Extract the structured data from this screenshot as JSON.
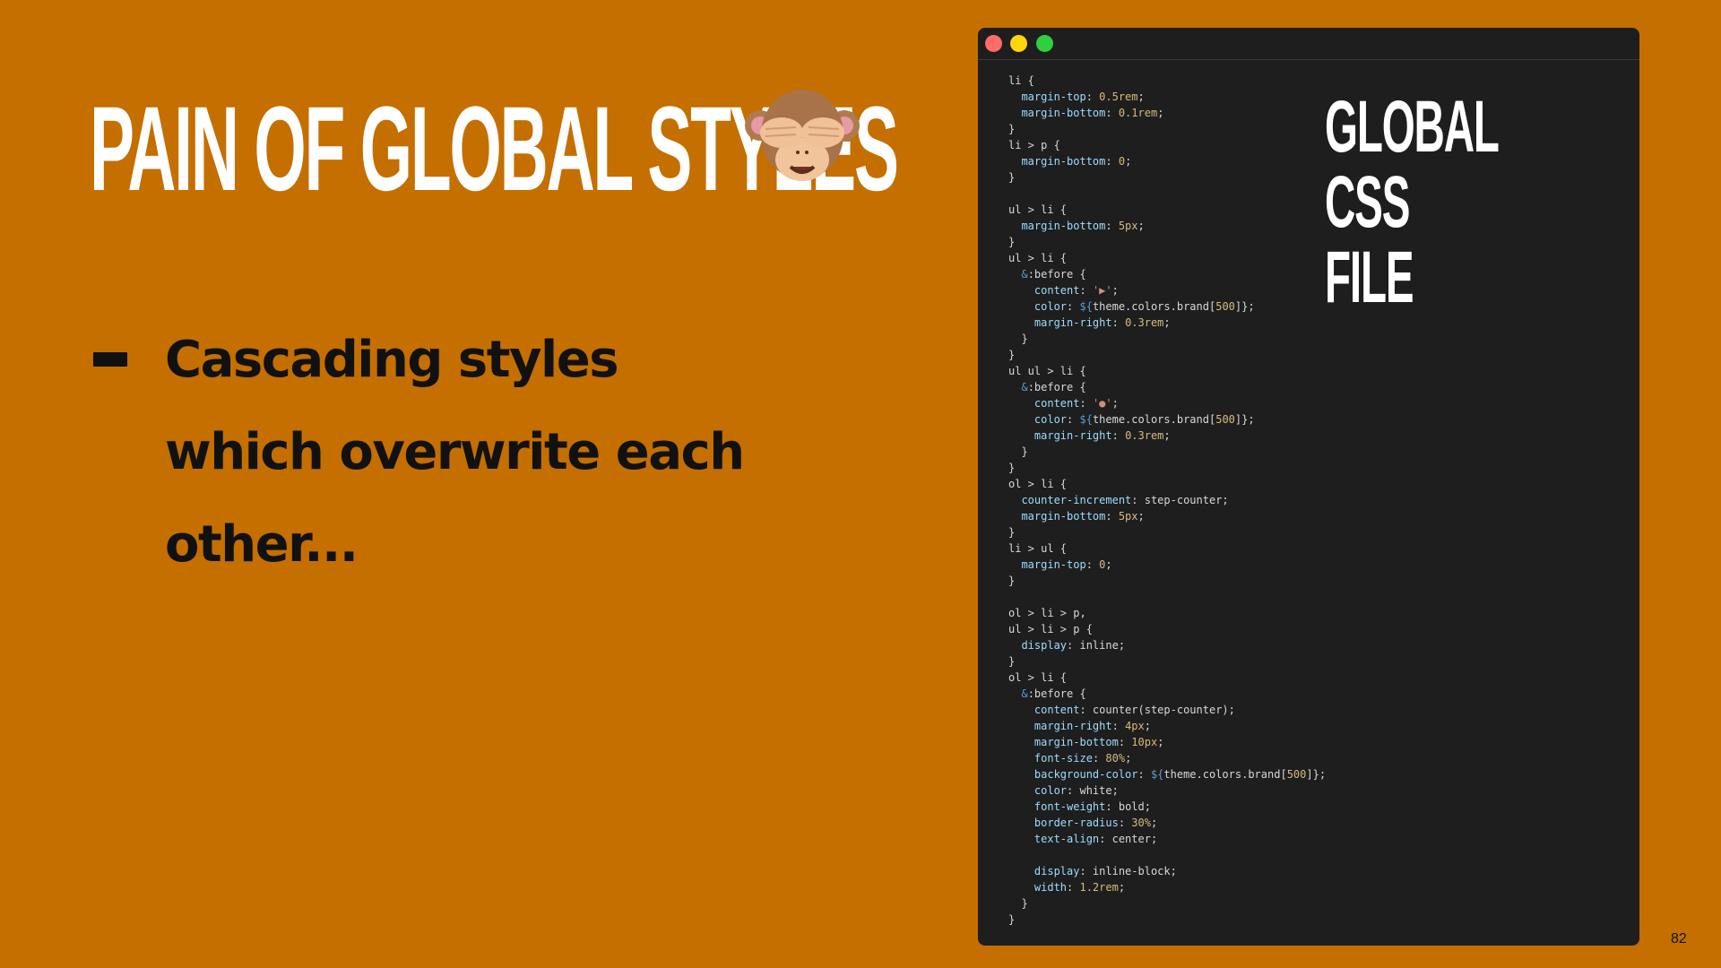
{
  "slide": {
    "title": "PAIN OF GLOBAL STYLES",
    "title_icon": "see-no-evil-monkey-icon",
    "bullets": [
      {
        "text": "Cascading styles which overwrite each other..."
      }
    ],
    "code_window": {
      "label": "GLOBAL CSS FILE",
      "controls": [
        "close-dot",
        "minimize-dot",
        "maximize-dot"
      ],
      "code": [
        "li {",
        "  margin-top: 0.5rem;",
        "  margin-bottom: 0.1rem;",
        "}",
        "li > p {",
        "  margin-bottom: 0;",
        "}",
        "",
        "ul > li {",
        "  margin-bottom: 5px;",
        "}",
        "ul > li {",
        "  &:before {",
        "    content: '▶';",
        "    color: ${theme.colors.brand[500]};",
        "    margin-right: 0.3rem;",
        "  }",
        "}",
        "ul ul > li {",
        "  &:before {",
        "    content: '●';",
        "    color: ${theme.colors.brand[500]};",
        "    margin-right: 0.3rem;",
        "  }",
        "}",
        "ol > li {",
        "  counter-increment: step-counter;",
        "  margin-bottom: 5px;",
        "}",
        "li > ul {",
        "  margin-top: 0;",
        "}",
        "",
        "ol > li > p,",
        "ul > li > p {",
        "  display: inline;",
        "}",
        "ol > li {",
        "  &:before {",
        "    content: counter(step-counter);",
        "    margin-right: 4px;",
        "    margin-bottom: 10px;",
        "    font-size: 80%;",
        "    background-color: ${theme.colors.brand[500]};",
        "    color: white;",
        "    font-weight: bold;",
        "    border-radius: 30%;",
        "    text-align: center;",
        "",
        "    display: inline-block;",
        "    width: 1.2rem;",
        "  }",
        "}"
      ]
    },
    "page_number": "82"
  },
  "colors": {
    "background": "#C46F00",
    "title": "#FFFFFF",
    "bullet_text": "#111111",
    "code_bg": "#1E1E1E"
  }
}
